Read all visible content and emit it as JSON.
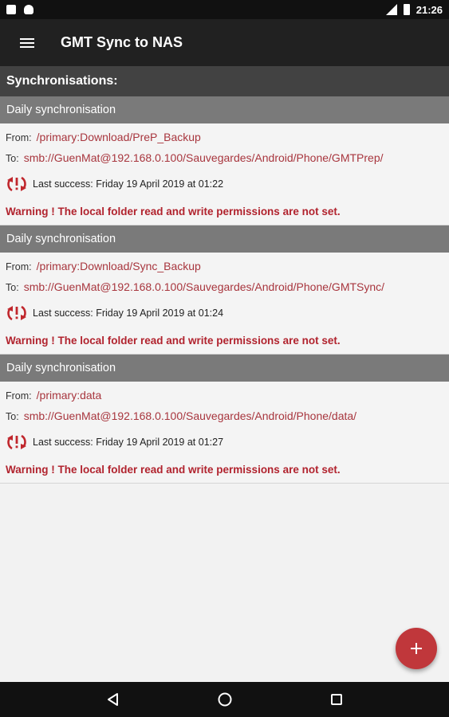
{
  "status_bar": {
    "time": "21:26",
    "icons": [
      "sd-card-icon",
      "android-icon",
      "signal-icon",
      "battery-icon"
    ]
  },
  "app_bar": {
    "title": "GMT Sync to NAS",
    "menu_icon": "hamburger-menu-icon"
  },
  "section": {
    "title": "Synchronisations:"
  },
  "syncs": [
    {
      "title": "Daily synchronisation",
      "from_label": "From:",
      "from": "/primary:Download/PreP_Backup",
      "to_label": "To:",
      "to": "smb://GuenMat@192.168.0.100/Sauvegardes/Android/Phone/GMTPrep/",
      "last_success": "Last success: Friday 19 April 2019 at 01:22",
      "warning": "Warning ! The local folder read and write permissions are not set."
    },
    {
      "title": "Daily synchronisation",
      "from_label": "From:",
      "from": "/primary:Download/Sync_Backup",
      "to_label": "To:",
      "to": "smb://GuenMat@192.168.0.100/Sauvegardes/Android/Phone/GMTSync/",
      "last_success": "Last success: Friday 19 April 2019 at 01:24",
      "warning": "Warning ! The local folder read and write permissions are not set."
    },
    {
      "title": "Daily synchronisation",
      "from_label": "From:",
      "from": "/primary:data",
      "to_label": "To:",
      "to": "smb://GuenMat@192.168.0.100/Sauvegardes/Android/Phone/data/",
      "last_success": "Last success: Friday 19 April 2019 at 01:27",
      "warning": "Warning ! The local folder read and write permissions are not set."
    }
  ],
  "fab": {
    "icon": "plus-icon"
  },
  "nav_bar": {
    "icons": [
      "back-icon",
      "home-icon",
      "recents-icon"
    ]
  },
  "colors": {
    "accent": "#c0373b",
    "path": "#a8363e",
    "warning": "#b1232e",
    "header": "#424242",
    "item_header": "#7a7a7a",
    "app_bar": "#212121"
  }
}
